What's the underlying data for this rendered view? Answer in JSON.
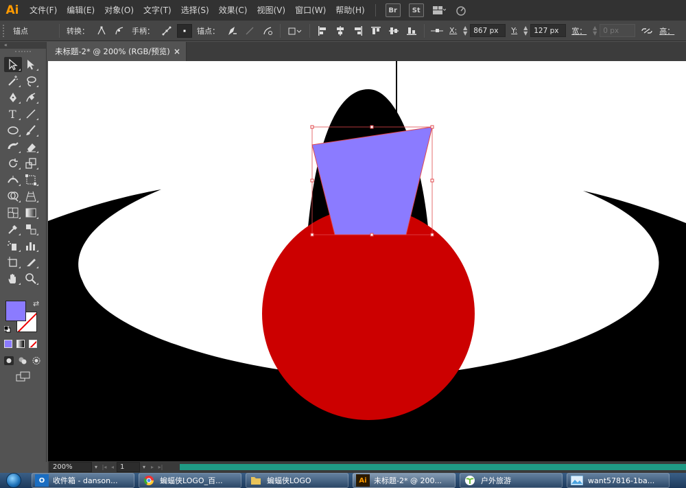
{
  "app": {
    "logo": "Ai",
    "accent": "#ff9a00"
  },
  "menu": [
    "文件(F)",
    "编辑(E)",
    "对象(O)",
    "文字(T)",
    "选择(S)",
    "效果(C)",
    "视图(V)",
    "窗口(W)",
    "帮助(H)"
  ],
  "menubar_buttons": {
    "br": "Br",
    "st": "St"
  },
  "control_bar": {
    "selection_type": "锚点",
    "convert_label": "转换：",
    "handles_label": "手柄：",
    "anchors_label": "锚点：",
    "x_label": "X:",
    "x_value": "867 px",
    "y_label": "Y:",
    "y_value": "127 px",
    "width_label": "宽：",
    "width_value": "0 px",
    "height_label": "高："
  },
  "document_tab": {
    "title": "未标题-2* @ 200% (RGB/预览)",
    "close": "×"
  },
  "tools": [
    [
      "selection-tool",
      "direct-selection-tool"
    ],
    [
      "magic-wand-tool",
      "lasso-tool"
    ],
    [
      "pen-tool",
      "curvature-tool"
    ],
    [
      "type-tool",
      "line-segment-tool"
    ],
    [
      "ellipse-tool",
      "paintbrush-tool"
    ],
    [
      "blob-brush-tool",
      "eraser-tool"
    ],
    [
      "rotate-tool",
      "scale-tool"
    ],
    [
      "width-tool",
      "free-transform-tool"
    ],
    [
      "shape-builder-tool",
      "perspective-grid-tool"
    ],
    [
      "mesh-tool",
      "gradient-tool"
    ],
    [
      "eyedropper-tool",
      "blend-tool"
    ],
    [
      "symbol-sprayer-tool",
      "column-graph-tool"
    ],
    [
      "artboard-tool",
      "slice-tool"
    ],
    [
      "hand-tool",
      "zoom-tool"
    ]
  ],
  "fill_color": "#8b7bff",
  "canvas": {
    "colors": {
      "black": "#000000",
      "red": "#cc0000",
      "purple": "#8b7bff",
      "selection": "#e0484c"
    }
  },
  "status_bar": {
    "zoom": "200%",
    "page": "1"
  },
  "taskbar": [
    {
      "label": "收件箱 - danson...",
      "icon": "outlook-icon",
      "icon_text": "O",
      "icon_color": "#1b6ec2"
    },
    {
      "label": "蝙蝠侠LOGO_百...",
      "icon": "chrome-icon",
      "icon_text": "",
      "icon_color": "#e33"
    },
    {
      "label": "蝙蝠侠LOGO",
      "icon": "folder-icon",
      "icon_text": "",
      "icon_color": "#e8c35a"
    },
    {
      "label": "未标题-2* @ 200...",
      "icon": "illustrator-icon",
      "icon_text": "Ai",
      "icon_color": "#ff9a00"
    },
    {
      "label": "户外旅游",
      "icon": "plant-icon",
      "icon_text": "",
      "icon_color": "#6bbf3a"
    },
    {
      "label": "want57816-1ba...",
      "icon": "image-icon",
      "icon_text": "",
      "icon_color": "#4aa3df"
    }
  ]
}
